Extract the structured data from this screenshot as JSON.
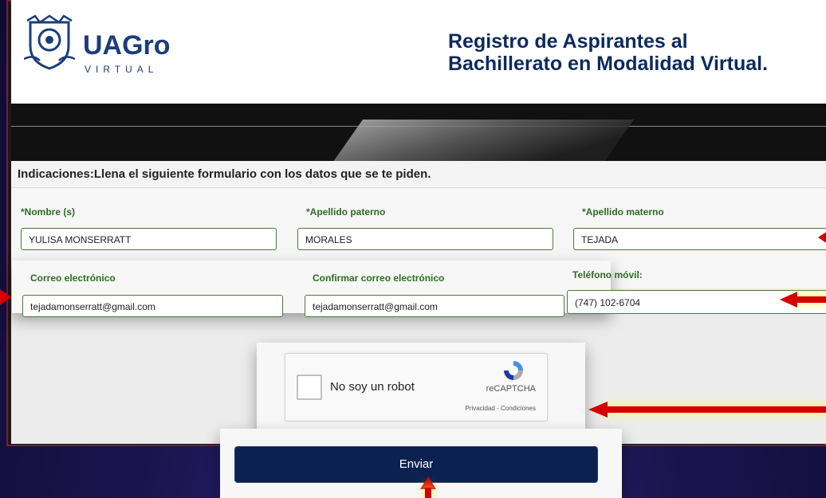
{
  "header": {
    "brand": "UAGro",
    "brand_sub": "VIRTUAL",
    "title_line1": "Registro de Aspirantes al",
    "title_line2": "Bachillerato en Modalidad Virtual."
  },
  "instructions": "Indicaciones:Llena el siguiente formulario con los datos que se te piden.",
  "form": {
    "nombre_label": "*Nombre (s)",
    "nombre_value": "YULISA MONSERRATT",
    "apellido_paterno_label": "*Apellido paterno",
    "apellido_paterno_value": "MORALES",
    "apellido_materno_label": "*Apellido materno",
    "apellido_materno_value": "TEJADA",
    "correo_label": "Correo electrónico",
    "correo_value": "tejadamonserratt@gmail.com",
    "confirmar_label": "Confirmar correo electrónico",
    "confirmar_value": "tejadamonserratt@gmail.com",
    "telefono_label": "Teléfono móvil:",
    "telefono_value": "(747) 102-6704"
  },
  "recaptcha": {
    "label": "No soy un robot",
    "brand": "reCAPTCHA",
    "links": "Privacidad - Condiciones"
  },
  "submit_label": "Enviar",
  "colors": {
    "accent": "#0c2150",
    "label_green": "#2e6b23",
    "arrow_red": "#d40000"
  }
}
